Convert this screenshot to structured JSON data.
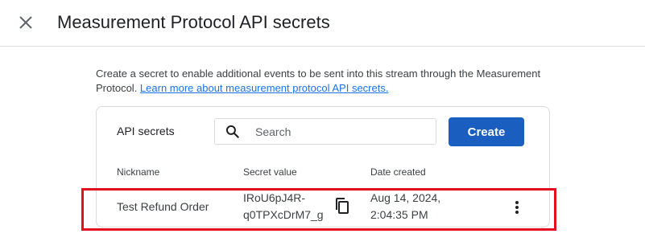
{
  "header": {
    "title": "Measurement Protocol API secrets",
    "close_icon": "close-icon"
  },
  "description": {
    "text": "Create a secret to enable additional events to be sent into this stream through the Measurement Protocol. ",
    "link_text": "Learn more about measurement protocol API secrets."
  },
  "card": {
    "title": "API secrets",
    "search": {
      "placeholder": "Search",
      "value": "",
      "icon": "search-icon"
    },
    "create_label": "Create",
    "columns": {
      "nickname": "Nickname",
      "secret_value": "Secret value",
      "date_created": "Date created"
    },
    "rows": [
      {
        "nickname": "Test Refund Order",
        "secret_line1": "IRoU6pJ4R-",
        "secret_line2": "q0TPXcDrM7_g",
        "date_line1": "Aug 14, 2024,",
        "date_line2": "2:04:35 PM",
        "copy_icon": "copy-icon",
        "more_icon": "more-vert-icon"
      }
    ]
  },
  "colors": {
    "primary_button": "#1a5fbf",
    "link": "#1a73e8",
    "highlight_box": "#e3101d"
  }
}
